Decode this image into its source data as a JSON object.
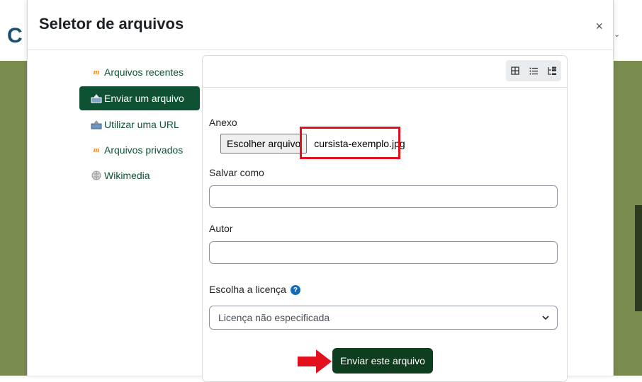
{
  "modal": {
    "title": "Seletor de arquivos",
    "close_symbol": "×"
  },
  "background": {
    "logo_letter": "C",
    "chevron": "⌄"
  },
  "sidebar": {
    "items": [
      {
        "label": "Arquivos recentes",
        "icon": "moodle-icon",
        "active": false
      },
      {
        "label": "Enviar um arquivo",
        "icon": "upload-icon",
        "active": true
      },
      {
        "label": "Utilizar uma URL",
        "icon": "url-icon",
        "active": false
      },
      {
        "label": "Arquivos privados",
        "icon": "moodle-icon",
        "active": false
      },
      {
        "label": "Wikimedia",
        "icon": "wikimedia-icon",
        "active": false
      }
    ]
  },
  "toolbar": {
    "views": [
      "icons-view-icon",
      "list-view-icon",
      "tree-view-icon"
    ]
  },
  "form": {
    "attachment_label": "Anexo",
    "choose_button": "Escolher arquivo",
    "file_name": "cursista-exemplo.jpg",
    "save_as_label": "Salvar como",
    "save_as_value": "",
    "author_label": "Autor",
    "author_value": "",
    "license_label": "Escolha a licença",
    "license_selected": "Licença não especificada",
    "submit_button": "Enviar este arquivo"
  },
  "colors": {
    "accent_green": "#0f5233",
    "submit_bg": "#0f3d1f",
    "highlight_red": "#e3101e",
    "background_olive": "#7a8c4e"
  }
}
